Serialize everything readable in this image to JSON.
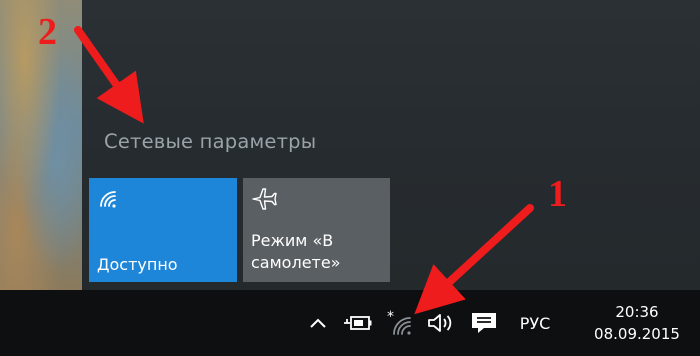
{
  "flyout": {
    "title": "Сетевые параметры",
    "tiles": [
      {
        "label": "Доступно",
        "icon": "wifi-icon",
        "state": "on",
        "color": "#1e86d8"
      },
      {
        "label_line1": "Режим «В",
        "label_line2": "самолете»",
        "icon": "airplane-icon",
        "state": "off",
        "color": "#5a5f63"
      }
    ]
  },
  "taskbar": {
    "tray_icons": [
      "chevron-up-icon",
      "battery-charging-icon",
      "wifi-available-icon",
      "speaker-icon",
      "action-center-icon"
    ],
    "language": "РУС",
    "time": "20:36",
    "date": "08.09.2015"
  },
  "annotations": {
    "marker_1": "1",
    "marker_2": "2",
    "color": "#ee1c1c"
  }
}
